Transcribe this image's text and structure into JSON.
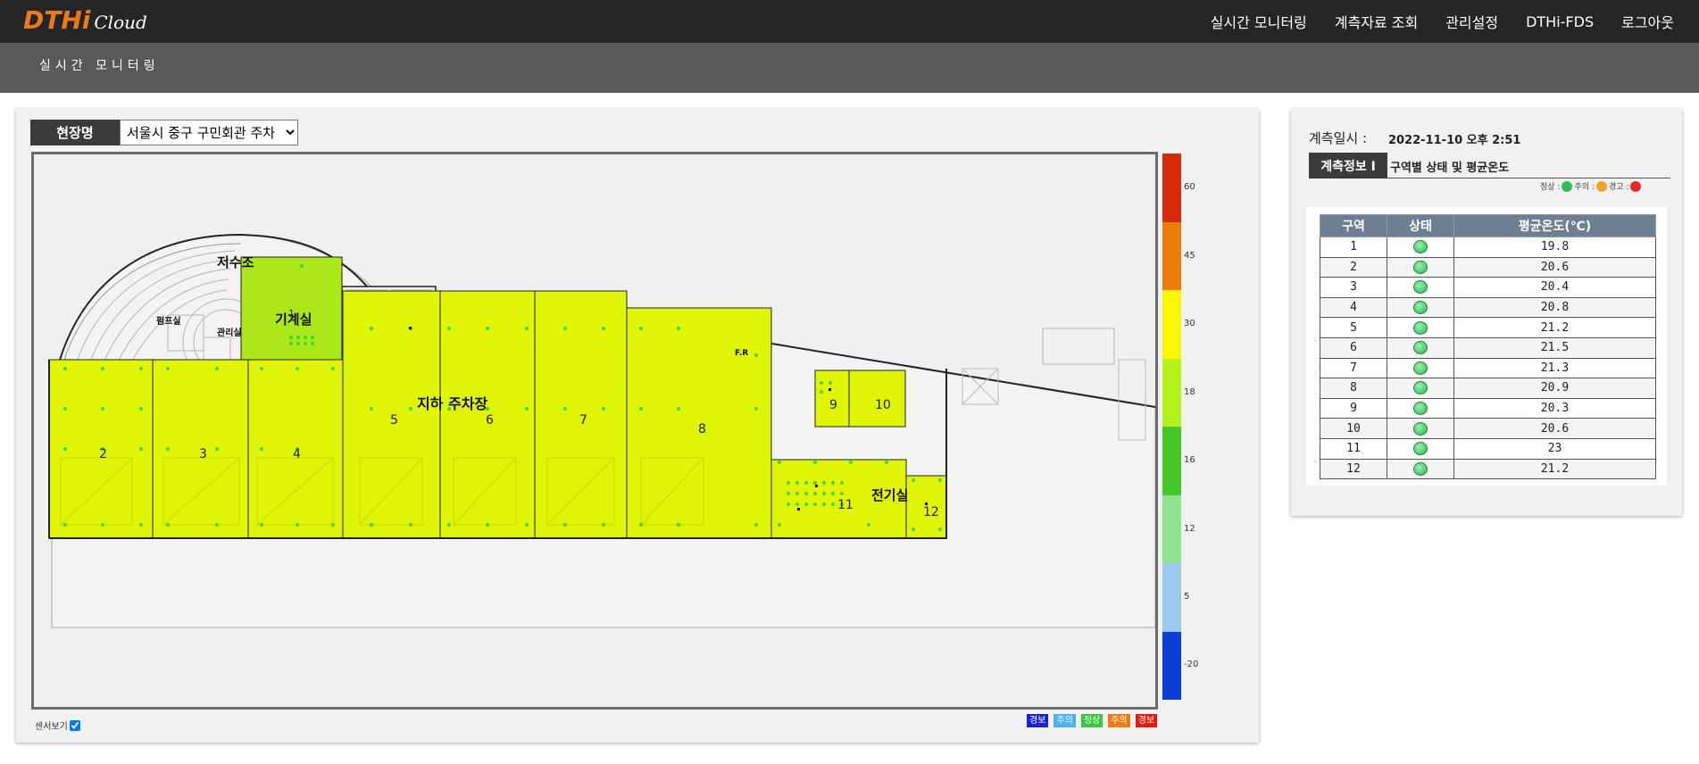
{
  "logo": {
    "main": "DTHi",
    "sub": "Cloud"
  },
  "nav": [
    "실시간 모니터링",
    "계측자료 조회",
    "관리설정",
    "DTHi-FDS",
    "로그아웃"
  ],
  "subheader": {
    "title": "실시간 모니터링"
  },
  "site": {
    "label": "현장명",
    "selected": "서울시 중구 구민회관 주차"
  },
  "map": {
    "labels": {
      "water_tank": "저수조",
      "machine_room": "기계실",
      "pump_room": "펌프실",
      "management_room": "관리실",
      "parking": "지하 주차장",
      "fr": "F.R",
      "electrical_room": "전기실",
      "one": "1"
    },
    "zones": [
      "2",
      "3",
      "4",
      "5",
      "6",
      "7",
      "8",
      "9",
      "10",
      "11",
      "12"
    ]
  },
  "legend_scale": {
    "ticks": [
      "60",
      "45",
      "30",
      "18",
      "16",
      "12",
      "5",
      "-20"
    ],
    "colors": [
      "#d42a08",
      "#ea7d07",
      "#fbf700",
      "#b6f21c",
      "#47c82a",
      "#8fe28e",
      "#9ac9ef",
      "#0b3ed2"
    ]
  },
  "sensor_toggle": {
    "label": "센서보기",
    "checked": true
  },
  "status_badges": [
    {
      "label": "경보",
      "color": "#1d23c8"
    },
    {
      "label": "주의",
      "color": "#4ab2ec"
    },
    {
      "label": "정상",
      "color": "#37c83b"
    },
    {
      "label": "주의",
      "color": "#ef7b12"
    },
    {
      "label": "경보",
      "color": "#e61a12"
    }
  ],
  "measurement": {
    "label": "계측일시 :",
    "value": "2022-11-10 오후 2:51"
  },
  "info": {
    "label": "계측정보 I",
    "desc": "구역별 상태 및 평균온도"
  },
  "status_legend": {
    "normal": "정상 :",
    "caution": "주의 :",
    "warning": "경고 :"
  },
  "table": {
    "headers": [
      "구역",
      "상태",
      "평균온도(℃)"
    ],
    "rows": [
      [
        "1",
        "19.8"
      ],
      [
        "2",
        "20.6"
      ],
      [
        "3",
        "20.4"
      ],
      [
        "4",
        "20.8"
      ],
      [
        "5",
        "21.2"
      ],
      [
        "6",
        "21.5"
      ],
      [
        "7",
        "21.3"
      ],
      [
        "8",
        "20.9"
      ],
      [
        "9",
        "20.3"
      ],
      [
        "10",
        "20.6"
      ],
      [
        "11",
        "23"
      ],
      [
        "12",
        "21.2"
      ]
    ]
  }
}
